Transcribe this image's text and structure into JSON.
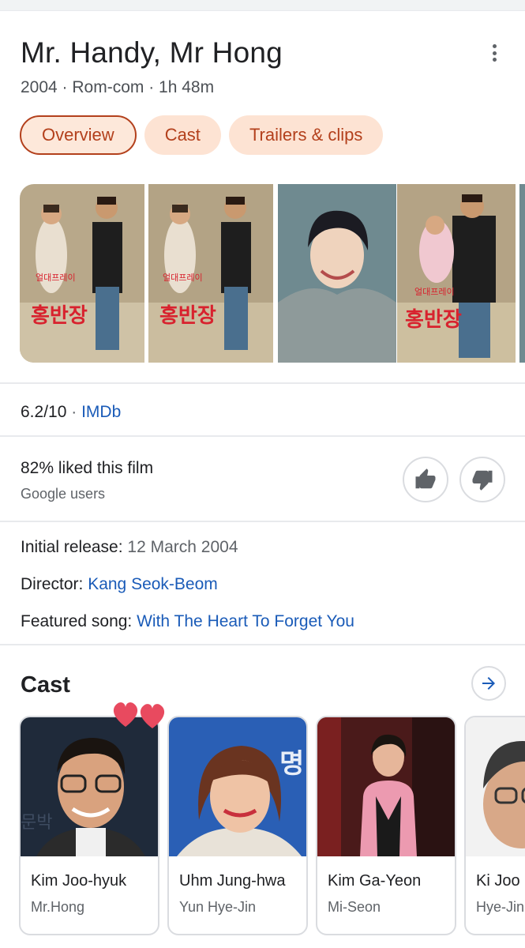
{
  "movie": {
    "title": "Mr. Handy, Mr Hong",
    "subtitle": "2004 · Rom-com · 1h 48m"
  },
  "tabs": [
    {
      "label": "Overview",
      "active": true
    },
    {
      "label": "Cast",
      "active": false
    },
    {
      "label": "Trailers & clips",
      "active": false
    }
  ],
  "rating": {
    "score": "6.2/10",
    "separator": "·",
    "source": "IMDb"
  },
  "audience": {
    "liked": "82% liked this film",
    "source": "Google users",
    "thumb_up_icon": "thumb-up-icon",
    "thumb_down_icon": "thumb-down-icon"
  },
  "facts": {
    "release_label": "Initial release: ",
    "release_value": "12 March 2004",
    "director_label": "Director: ",
    "director_value": "Kang Seok-Beom",
    "song_label": "Featured song: ",
    "song_value": "With The Heart To Forget You"
  },
  "cast_section": {
    "title": "Cast",
    "members": [
      {
        "name": "Kim Joo-hyuk",
        "role": "Mr.Hong"
      },
      {
        "name": "Uhm Jung-hwa",
        "role": "Yun Hye-Jin"
      },
      {
        "name": "Kim Ga-Yeon",
        "role": "Mi-Seon"
      },
      {
        "name": "Ki Joo",
        "role": "Hye-Jin"
      }
    ]
  },
  "colors": {
    "chip_bg": "#fde3d3",
    "chip_text": "#b3401c",
    "link": "#1a5bb8",
    "heart": "#e84a5f"
  }
}
